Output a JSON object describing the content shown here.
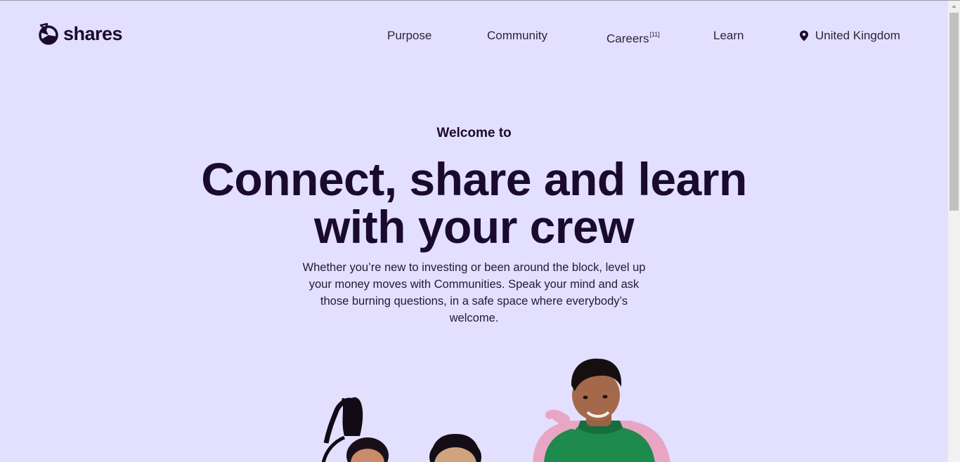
{
  "brand": {
    "name": "shares"
  },
  "nav": {
    "items": [
      {
        "label": "Purpose"
      },
      {
        "label": "Community"
      },
      {
        "label": "Careers",
        "badge": "[11]"
      },
      {
        "label": "Learn"
      }
    ],
    "region": "United Kingdom",
    "region_icon": "location-pin-icon"
  },
  "hero": {
    "eyebrow": "Welcome to",
    "headline_line1": "Connect, share and learn",
    "headline_line2": "with your crew",
    "subtext": "Whether you’re new to investing or been around the block, level up your money moves with Communities. Speak your mind and ask those burning questions, in a safe space where everybody’s welcome."
  },
  "colors": {
    "background": "#e3dfff",
    "text": "#1a0a2e",
    "shirt_green": "#1e8a4c",
    "jacket_pink": "#e8a6c4"
  }
}
